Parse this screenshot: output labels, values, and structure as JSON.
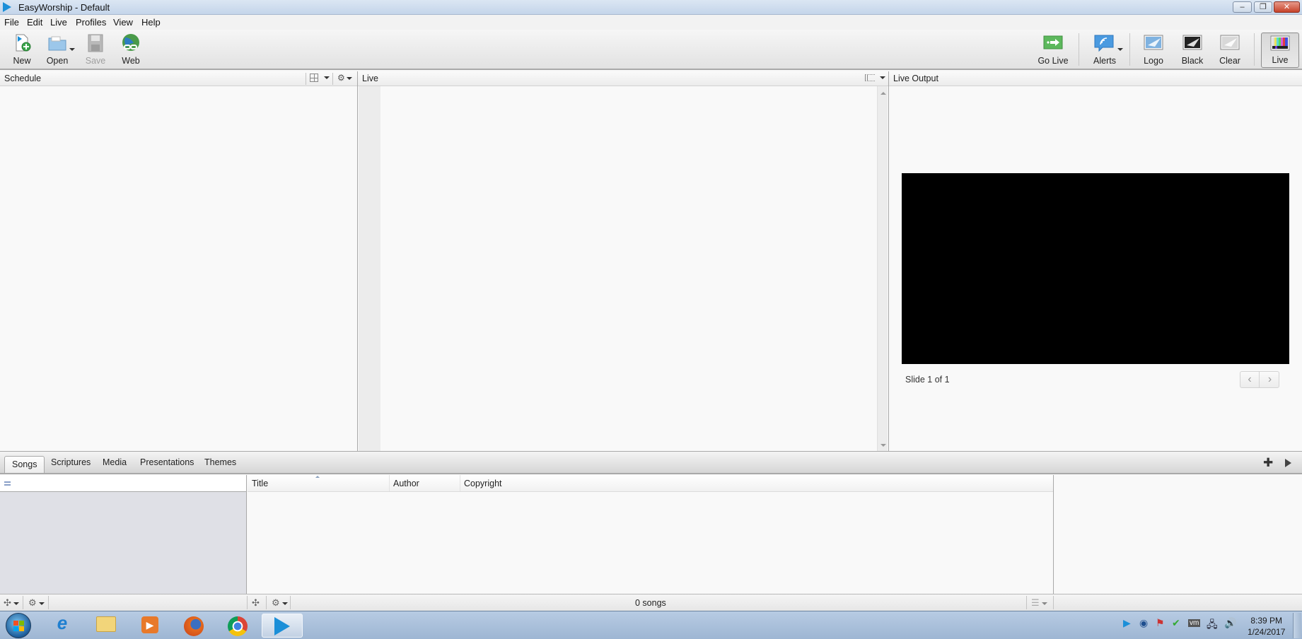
{
  "window": {
    "title": "EasyWorship - Default",
    "controls": {
      "minimize": "–",
      "restore": "❐",
      "close": "✕"
    }
  },
  "menu": [
    "File",
    "Edit",
    "Live",
    "Profiles",
    "View",
    "Help"
  ],
  "toolbar": {
    "left": [
      {
        "id": "new",
        "label": "New",
        "icon": "new-document-icon",
        "enabled": true
      },
      {
        "id": "open",
        "label": "Open",
        "icon": "folder-icon",
        "enabled": true,
        "dropdown": true
      },
      {
        "id": "save",
        "label": "Save",
        "icon": "floppy-disk-icon",
        "enabled": false
      },
      {
        "id": "web",
        "label": "Web",
        "icon": "globe-link-icon",
        "enabled": true
      }
    ],
    "right": [
      {
        "id": "go-live",
        "label": "Go Live",
        "icon": "go-live-arrow-icon"
      },
      {
        "id": "alerts",
        "label": "Alerts",
        "icon": "alerts-bubble-icon",
        "dropdown": true
      },
      {
        "id": "logo",
        "label": "Logo",
        "icon": "logo-screen-icon"
      },
      {
        "id": "black",
        "label": "Black",
        "icon": "black-screen-icon"
      },
      {
        "id": "clear",
        "label": "Clear",
        "icon": "clear-screen-icon"
      },
      {
        "id": "live",
        "label": "Live",
        "icon": "color-bars-icon",
        "pressed": true
      }
    ]
  },
  "panels": {
    "schedule": {
      "title": "Schedule"
    },
    "live": {
      "title": "Live"
    },
    "live_output": {
      "title": "Live Output",
      "slide_info": "Slide 1 of 1",
      "prev": "‹",
      "next": "›"
    }
  },
  "library": {
    "tabs": [
      "Songs",
      "Scriptures",
      "Media",
      "Presentations",
      "Themes"
    ],
    "active_tab": "Songs",
    "columns": [
      "Title",
      "Author",
      "Copyright"
    ],
    "rows": [],
    "count_text": "0 songs"
  },
  "taskbar": {
    "apps": [
      {
        "name": "internet-explorer",
        "glyph": "e",
        "color": "#1f7fd0"
      },
      {
        "name": "file-explorer",
        "glyph": "▬",
        "color": "#e8c45c"
      },
      {
        "name": "media-player",
        "glyph": "▶",
        "color": "#e8792a"
      },
      {
        "name": "firefox",
        "glyph": "●",
        "color": "#e66a1c"
      },
      {
        "name": "chrome",
        "glyph": "◉",
        "color": "#3f82e0"
      },
      {
        "name": "easyworship",
        "glyph": "▶",
        "color": "#1b8fd8",
        "active": true
      }
    ],
    "tray_icons": [
      "easyworship-tray",
      "quicktime",
      "action-center-flag",
      "usb-safely-remove",
      "vmware",
      "network",
      "volume"
    ],
    "time": "8:39 PM",
    "date": "1/24/2017"
  }
}
